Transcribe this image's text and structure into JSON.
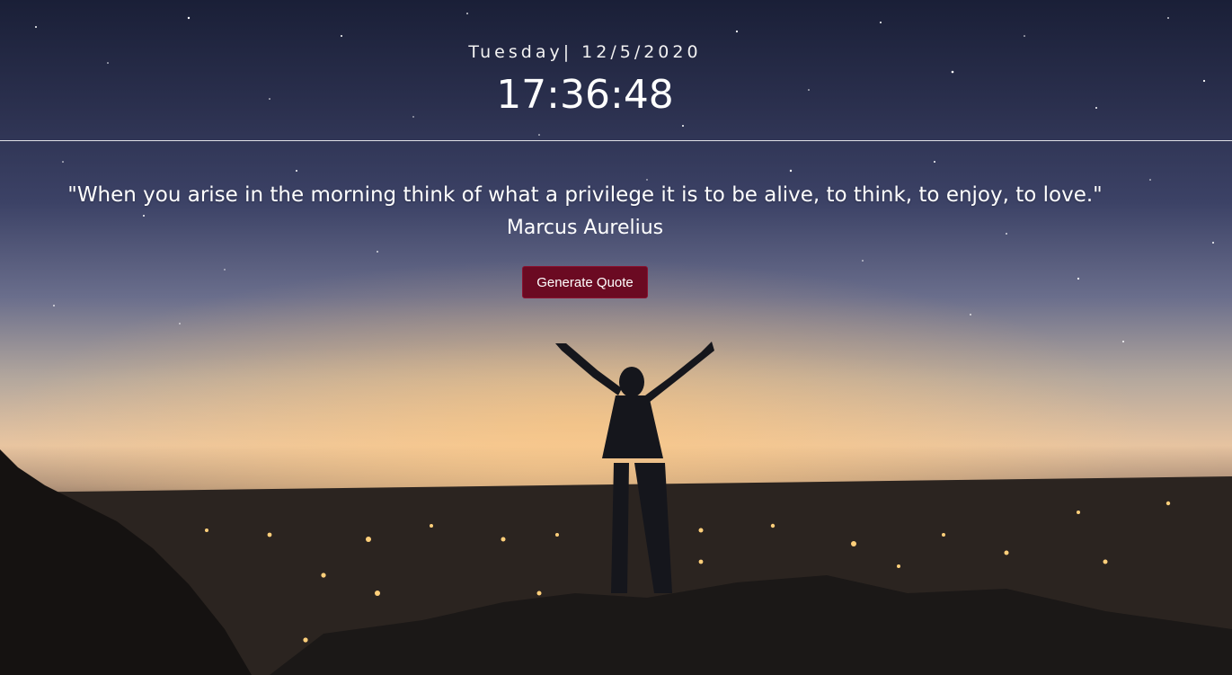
{
  "header": {
    "date": "Tuesday| 12/5/2020",
    "time": "17:36:48"
  },
  "quote": {
    "text": "\"When you arise in the morning think of what a privilege it is to be alive, to think, to enjoy, to love.\"",
    "author": "Marcus Aurelius"
  },
  "actions": {
    "generate_label": "Generate Quote"
  },
  "colors": {
    "button_bg": "#6b0a22",
    "text": "#ffffff"
  }
}
